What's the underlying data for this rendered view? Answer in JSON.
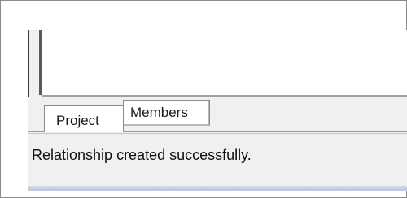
{
  "tabs": [
    {
      "label": "Project"
    },
    {
      "label": "Members"
    }
  ],
  "status": {
    "message": "Relationship created successfully."
  }
}
